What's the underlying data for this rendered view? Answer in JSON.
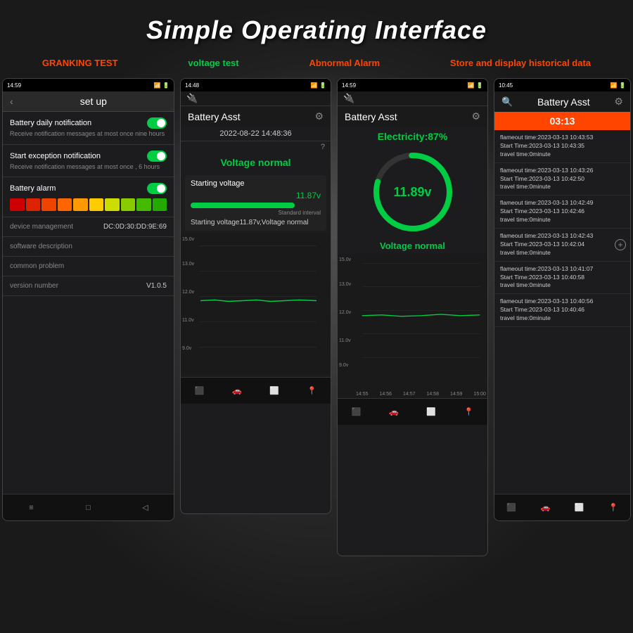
{
  "header": {
    "title": "Simple Operating Interface"
  },
  "tabs": [
    {
      "label": "GRANKING TEST",
      "color": "orange"
    },
    {
      "label": "voltage test",
      "color": "green"
    },
    {
      "label": "Abnormal Alarm",
      "color": "orange"
    },
    {
      "label": "Store and display historical data",
      "color": "orange"
    }
  ],
  "screen1": {
    "statusBar": "14:59",
    "title": "set up",
    "settings": [
      {
        "title": "Battery daily notification",
        "desc": "Receive notification messages at most once nine hours",
        "toggleOn": true
      },
      {
        "title": "Start exception notification",
        "desc": "Receive notification messages at most once , 6 hours",
        "toggleOn": true
      },
      {
        "title": "Battery alarm",
        "desc": "",
        "toggleOn": true
      }
    ],
    "deviceManagement": "device management",
    "deviceId": "DC:0D:30:DD:9E:69",
    "softwareDescription": "software description",
    "commonProblem": "common problem",
    "versionNumber": "version number",
    "versionValue": "V1.0.5"
  },
  "screen2": {
    "statusBar": "14:48",
    "title": "Battery Asst",
    "datetime": "2022-08-22 14:48:36",
    "voltageStatus": "Voltage normal",
    "startingVoltageLabel": "Starting voltage",
    "startingVoltageValue": "11.87v",
    "standardInterval": "Standard interval",
    "startingVoltageNormal": "Starting voltage11.87v,Voltage normal",
    "chartLabels": [
      "15.0v",
      "13.0v",
      "12.0v",
      "11.0v",
      "9.0v"
    ]
  },
  "screen3": {
    "statusBar": "14:59",
    "title": "Battery Asst",
    "electricity": "Electricity:87%",
    "gaugeValue": "11.89v",
    "voltageStatus": "Voltage normal",
    "chartLabels": [
      "15.0v",
      "13.0v",
      "12.0v",
      "11.0v",
      "9.0v"
    ],
    "timeLabels": [
      "14:55",
      "14:56",
      "14:57",
      "14:58",
      "14:59",
      "15:00"
    ]
  },
  "screen4": {
    "statusBar": "10:45",
    "title": "Battery Asst",
    "currentTime": "03:13",
    "historyItems": [
      {
        "flameout": "flameout time:2023-03-13 10:43:53",
        "start": "Start Time:2023-03-13 10:43:35",
        "travel": "travel time:0minute"
      },
      {
        "flameout": "flameout time:2023-03-13 10:43:26",
        "start": "Start Time:2023-03-13 10:42:50",
        "travel": "travel time:0minute"
      },
      {
        "flameout": "flameout time:2023-03-13 10:42:49",
        "start": "Start Time:2023-03-13 10:42:46",
        "travel": "travel time:0minute"
      },
      {
        "flameout": "flameout time:2023-03-13 10:42:43",
        "start": "Start Time:2023-03-13 10:42:04",
        "travel": "travel time:0minute"
      },
      {
        "flameout": "flameout time:2023-03-13 10:41:07",
        "start": "Start Time:2023-03-13 10:40:58",
        "travel": "travel time:0minute"
      },
      {
        "flameout": "flameout time:2023-03-13 10:40:56",
        "start": "Start Time:2023-03-13 10:40:46",
        "travel": "travel time:0minute"
      }
    ]
  },
  "icons": {
    "back": "‹",
    "gear": "⚙",
    "menu": "≡",
    "square": "□",
    "triangle": "◁",
    "location": "⊙",
    "camera": "⬟",
    "add": "+"
  }
}
